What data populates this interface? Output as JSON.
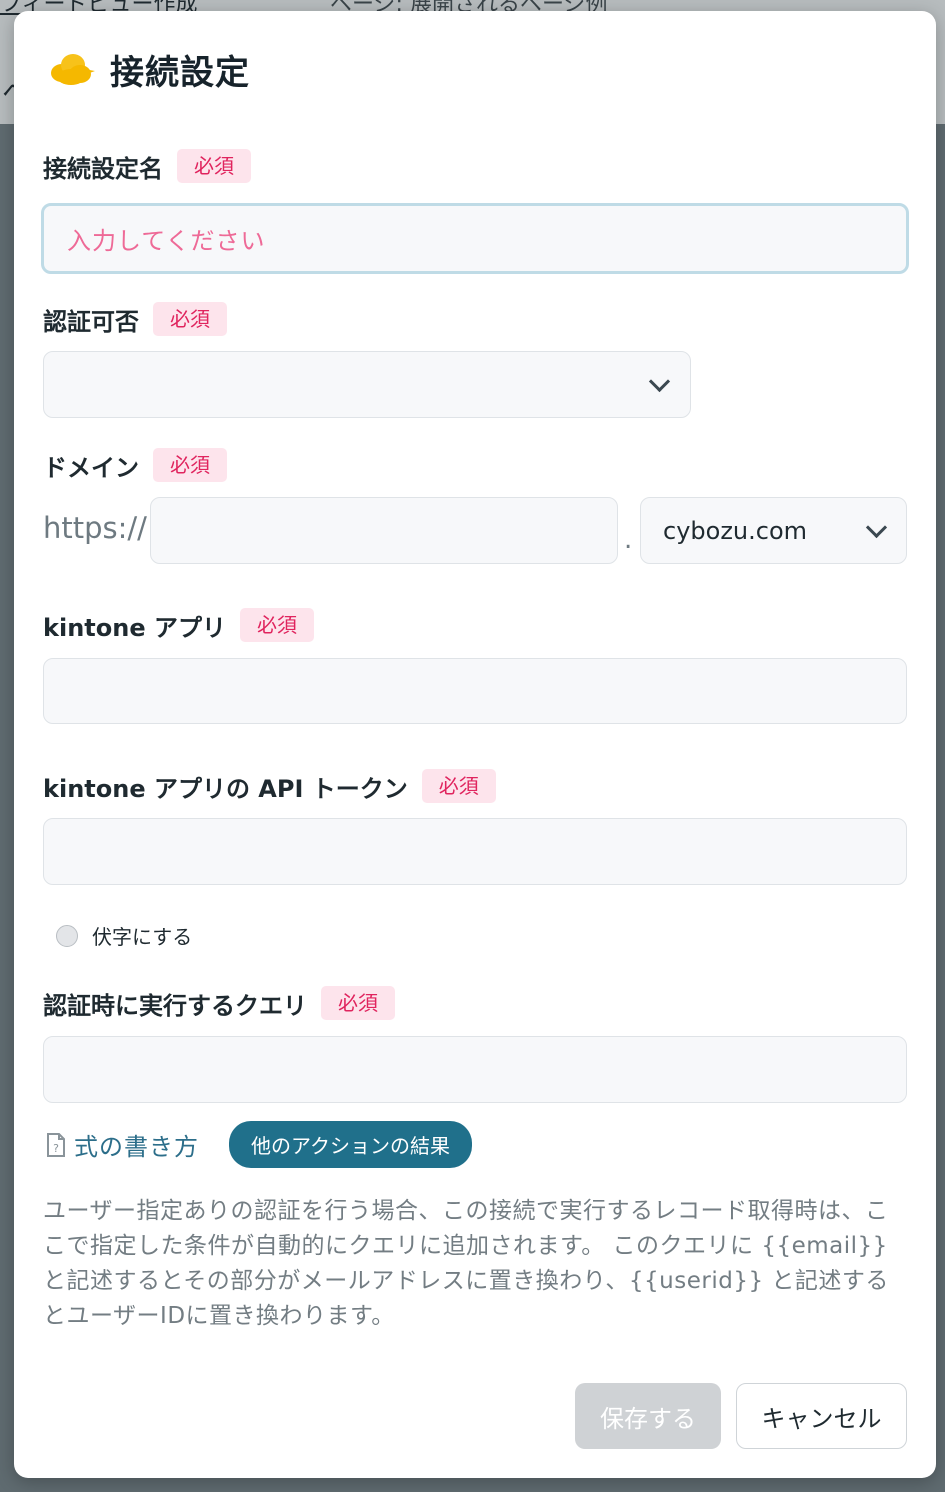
{
  "background": {
    "link_text": "フィードビュー作成",
    "text": "ページ: 展開されるページ例",
    "mark": "ヘ"
  },
  "modal": {
    "title": "接続設定",
    "icon": "cloud-icon"
  },
  "required_label": "必須",
  "fields": {
    "connection_name": {
      "label": "接続設定名",
      "placeholder": "入力してください"
    },
    "auth": {
      "label": "認証可否",
      "value": ""
    },
    "domain": {
      "label": "ドメイン",
      "prefix": "https://",
      "separator": ".",
      "subdomain_value": "",
      "suffix_value": "cybozu.com"
    },
    "kintone_app": {
      "label": "kintone アプリ",
      "value": ""
    },
    "api_token": {
      "label": "kintone アプリの API トークン",
      "value": "",
      "mask_label": "伏字にする"
    },
    "auth_query": {
      "label": "認証時に実行するクエリ",
      "value": "",
      "help_link": "式の書き方",
      "other_results_button": "他のアクションの結果",
      "description": "ユーザー指定ありの認証を行う場合、この接続で実行するレコード取得時は、ここで指定した条件が自動的にクエリに追加されます。 このクエリに {{email}} と記述するとその部分がメールアドレスに置き換わり、{{userid}} と記述するとユーザーIDに置き換わります。"
    }
  },
  "buttons": {
    "save": "保存する",
    "cancel": "キャンセル"
  },
  "colors": {
    "required_bg": "#fde4ec",
    "required_text": "#e0245e",
    "accent": "#20708b",
    "save_disabled": "#cfd2d5"
  }
}
